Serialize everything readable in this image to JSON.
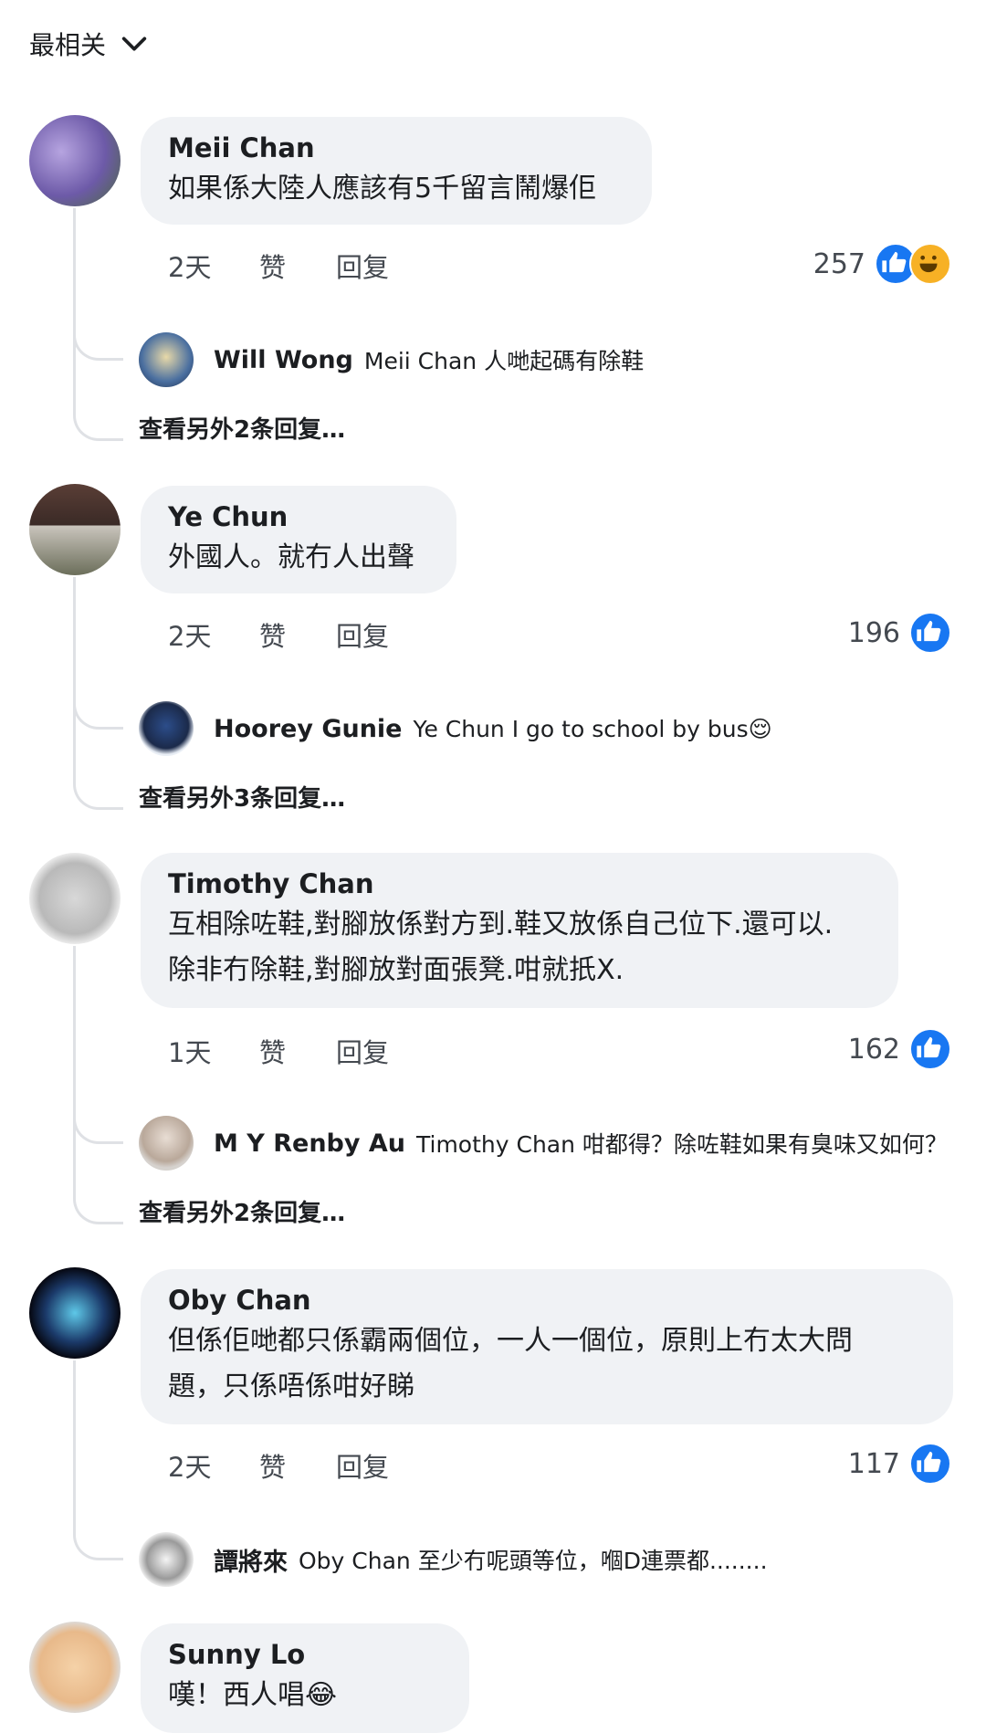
{
  "sort": {
    "label": "最相关"
  },
  "comments": [
    {
      "author": "Meii Chan",
      "text": "如果係大陸人應該有5千留言鬧爆佢",
      "time": "2天",
      "like": "赞",
      "reply": "回复",
      "reaction_count": "257",
      "reactions": [
        "like-icon",
        "haha-icon"
      ],
      "reply_preview": {
        "author": "Will Wong",
        "text": "Meii Chan 人哋起碼有除鞋"
      },
      "more_replies": "查看另外2条回复…"
    },
    {
      "author": "Ye Chun",
      "text": "外國人。就冇人出聲",
      "time": "2天",
      "like": "赞",
      "reply": "回复",
      "reaction_count": "196",
      "reactions": [
        "like-icon"
      ],
      "reply_preview": {
        "author": "Hoorey Gunie",
        "text": "Ye Chun I go to school by bus😌"
      },
      "more_replies": "查看另外3条回复…"
    },
    {
      "author": "Timothy Chan",
      "text_lines": [
        "互相除咗鞋,對腳放係對方到.鞋又放係自己位下.還可以.",
        "除非冇除鞋,對腳放對面張凳.咁就扺X."
      ],
      "time": "1天",
      "like": "赞",
      "reply": "回复",
      "reaction_count": "162",
      "reactions": [
        "like-icon"
      ],
      "reply_preview": {
        "author": "M Y Renby Au",
        "text": "Timothy Chan 咁都得？除咗鞋如果有臭味又如何？"
      },
      "more_replies": "查看另外2条回复…"
    },
    {
      "author": "Oby Chan",
      "text_lines": [
        "但係佢哋都只係霸兩個位，一人一個位，原則上冇太大問",
        "題，只係唔係咁好睇"
      ],
      "time": "2天",
      "like": "赞",
      "reply": "回复",
      "reaction_count": "117",
      "reactions": [
        "like-icon"
      ],
      "reply_preview": {
        "author": "譚將來",
        "text": "Oby Chan 至少冇呢頭等位，嗰D連票都........"
      }
    },
    {
      "author": "Sunny Lo",
      "text": "嘆！西人唱😂"
    }
  ],
  "colors": {
    "bubble": "#f0f2f5",
    "like_blue": "#1877f2",
    "haha_yellow": "#f7b125"
  }
}
